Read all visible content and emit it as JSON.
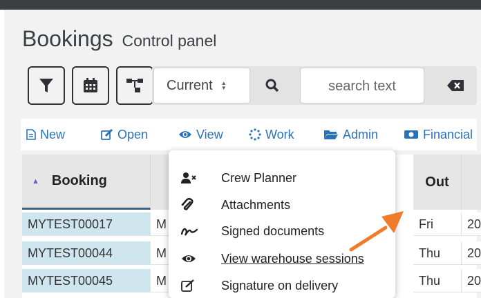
{
  "page": {
    "title": "Bookings",
    "subtitle": "Control panel"
  },
  "toolbar": {
    "filter_icon": "funnel-icon",
    "calendar_icon": "calendar-icon",
    "hierarchy_icon": "sitemap-icon",
    "period_select_value": "Current",
    "search_icon": "magnifier-icon",
    "search_placeholder": "search text",
    "clear_icon": "backspace-icon"
  },
  "actions": [
    {
      "label": "New",
      "icon": "file-icon"
    },
    {
      "label": "Open",
      "icon": "edit-icon"
    },
    {
      "label": "View",
      "icon": "eye-icon"
    },
    {
      "label": "Work",
      "icon": "spinner-icon"
    },
    {
      "label": "Admin",
      "icon": "folder-icon"
    },
    {
      "label": "Financial",
      "icon": "money-icon"
    }
  ],
  "grid": {
    "columns": [
      "Booking",
      "",
      "Out",
      ""
    ],
    "sort_column": "Booking",
    "rows": [
      {
        "booking": "MYTEST00017",
        "c2": "M",
        "out": "Fri",
        "last": "20"
      },
      {
        "booking": "MYTEST00044",
        "c2": "M",
        "out": "Thu",
        "last": "20"
      },
      {
        "booking": "MYTEST00045",
        "c2": "M",
        "out": "Thu",
        "last": "20"
      }
    ]
  },
  "work_menu": {
    "items": [
      {
        "label": "Crew Planner",
        "icon": "user-x-icon"
      },
      {
        "label": "Attachments",
        "icon": "paperclip-icon"
      },
      {
        "label": "Signed documents",
        "icon": "signature-icon"
      },
      {
        "label": "View warehouse sessions",
        "icon": "eye-icon"
      },
      {
        "label": "Signature on delivery",
        "icon": "pen-square-icon"
      }
    ],
    "hovered_item": "View warehouse sessions"
  },
  "colors": {
    "accent_link": "#2a72b8",
    "selected_cell": "#cfe6ee",
    "pointer_arrow": "#f07b2a",
    "dark_bar": "#3b3f44"
  }
}
